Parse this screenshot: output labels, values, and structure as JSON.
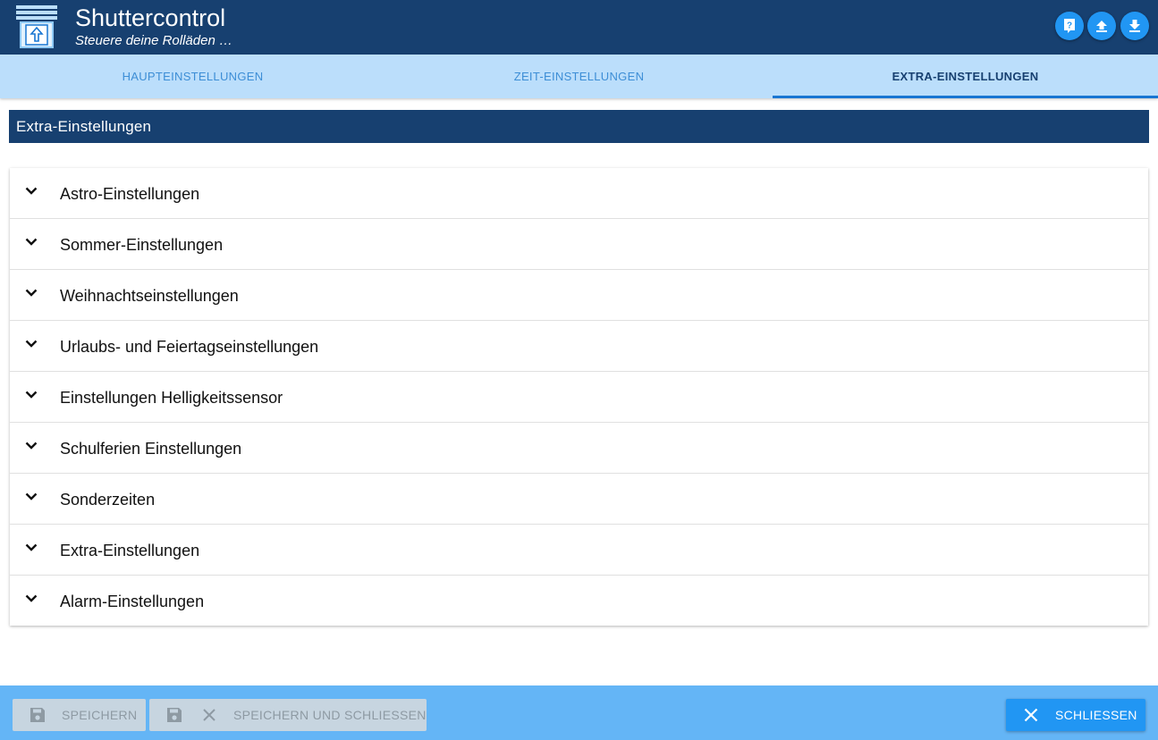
{
  "app": {
    "title": "Shuttercontrol",
    "subtitle": "Steuere deine Rolläden …",
    "logo_icon": "shutter-logo-icon"
  },
  "header_buttons": [
    {
      "icon": "help-icon"
    },
    {
      "icon": "upload-icon"
    },
    {
      "icon": "download-icon"
    }
  ],
  "tabs": [
    {
      "label": "HAUPTEINSTELLUNGEN",
      "active": false
    },
    {
      "label": "ZEIT-EINSTELLUNGEN",
      "active": false
    },
    {
      "label": "EXTRA-EINSTELLUNGEN",
      "active": true
    }
  ],
  "section": {
    "title": "Extra-Einstellungen"
  },
  "accordion": [
    {
      "label": "Astro-Einstellungen"
    },
    {
      "label": "Sommer-Einstellungen"
    },
    {
      "label": "Weihnachtseinstellungen"
    },
    {
      "label": "Urlaubs- und Feiertagseinstellungen"
    },
    {
      "label": "Einstellungen Helligkeitssensor"
    },
    {
      "label": "Schulferien Einstellungen"
    },
    {
      "label": "Sonderzeiten"
    },
    {
      "label": "Extra-Einstellungen"
    },
    {
      "label": "Alarm-Einstellungen"
    }
  ],
  "footer": {
    "save_label": "SPEICHERN",
    "save_close_label": "SPEICHERN UND SCHLIESSEN",
    "close_label": "SCHLIESSEN"
  },
  "colors": {
    "header_bg": "#174070",
    "tab_bg": "#bbdefb",
    "accent": "#2196f3",
    "footer_bg": "#64b5f6"
  }
}
